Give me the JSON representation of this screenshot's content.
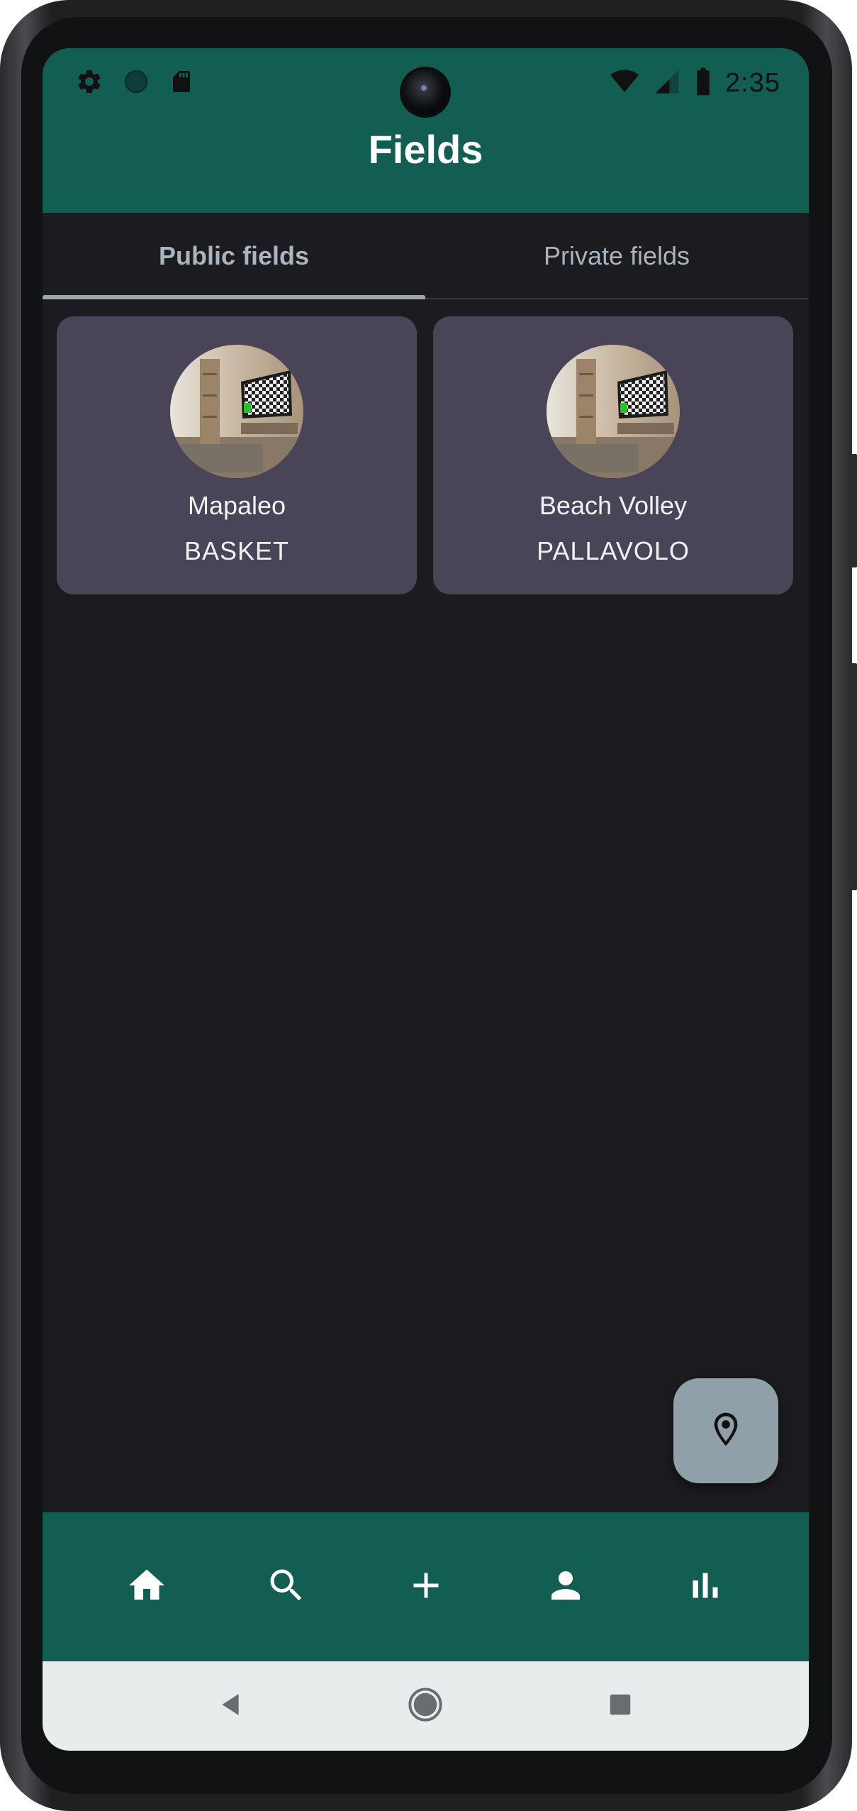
{
  "status_bar": {
    "time": "2:35",
    "left_icons": [
      "settings-icon",
      "circle-icon",
      "sd-card-icon"
    ],
    "right_icons": [
      "wifi-icon",
      "cell-signal-icon",
      "battery-icon"
    ]
  },
  "app_bar": {
    "title": "Fields"
  },
  "tabs": [
    {
      "label": "Public fields",
      "selected": true
    },
    {
      "label": "Private fields",
      "selected": false
    }
  ],
  "fields": [
    {
      "name": "Mapaleo",
      "sport": "BASKET"
    },
    {
      "name": "Beach Volley",
      "sport": "PALLAVOLO"
    }
  ],
  "fab": {
    "icon": "location-pin-icon"
  },
  "bottom_nav": [
    {
      "icon": "home-icon"
    },
    {
      "icon": "search-icon"
    },
    {
      "icon": "add-icon"
    },
    {
      "icon": "person-icon"
    },
    {
      "icon": "bar-chart-icon"
    }
  ],
  "system_nav": [
    "back-icon",
    "home-circle-icon",
    "recents-icon"
  ],
  "colors": {
    "primary": "#135e53",
    "background": "#1c1b1f",
    "card": "#4a4458",
    "fab": "#8fa0a8",
    "tab_indicator": "#9aa9b1",
    "system_nav_background": "#e8eced"
  }
}
